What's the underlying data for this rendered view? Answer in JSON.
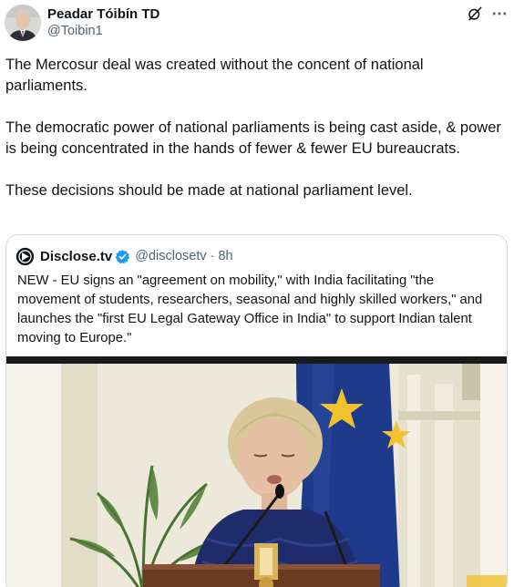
{
  "author": {
    "display_name": "Peadar Tóibín TD",
    "handle": "@Toibin1",
    "avatar_icon": "avatar-portrait"
  },
  "actions": {
    "grok_icon": "grok-slash-icon",
    "more_icon": "more-horizontal-icon"
  },
  "post": {
    "paragraphs": [
      "The Mercosur deal was created without the concent of national parliaments.",
      "The democratic power of national parliaments is being cast aside, & power is being concentrated in the hands of fewer & fewer EU bureaucrats.",
      "These decisions should be made at national parliament level."
    ]
  },
  "quoted_post": {
    "display_name": "Disclose.tv",
    "verified": true,
    "handle": "@disclosetv",
    "separator": "·",
    "time": "8h",
    "text": "NEW - EU signs an \"agreement on mobility,\" with India  facilitating \"the movement of students, researchers, seasonal and highly skilled workers,\" and launches the \"first EU Legal Gateway Office in India\" to support Indian talent moving to Europe.\"",
    "media": "video-thumbnail"
  },
  "colors": {
    "text_primary": "#0f1419",
    "text_secondary": "#536471",
    "border": "#cfd9de",
    "verified_blue": "#1d9bf0",
    "eu_flag_blue": "#1e3a8a",
    "eu_star_yellow": "#f2c12e"
  }
}
